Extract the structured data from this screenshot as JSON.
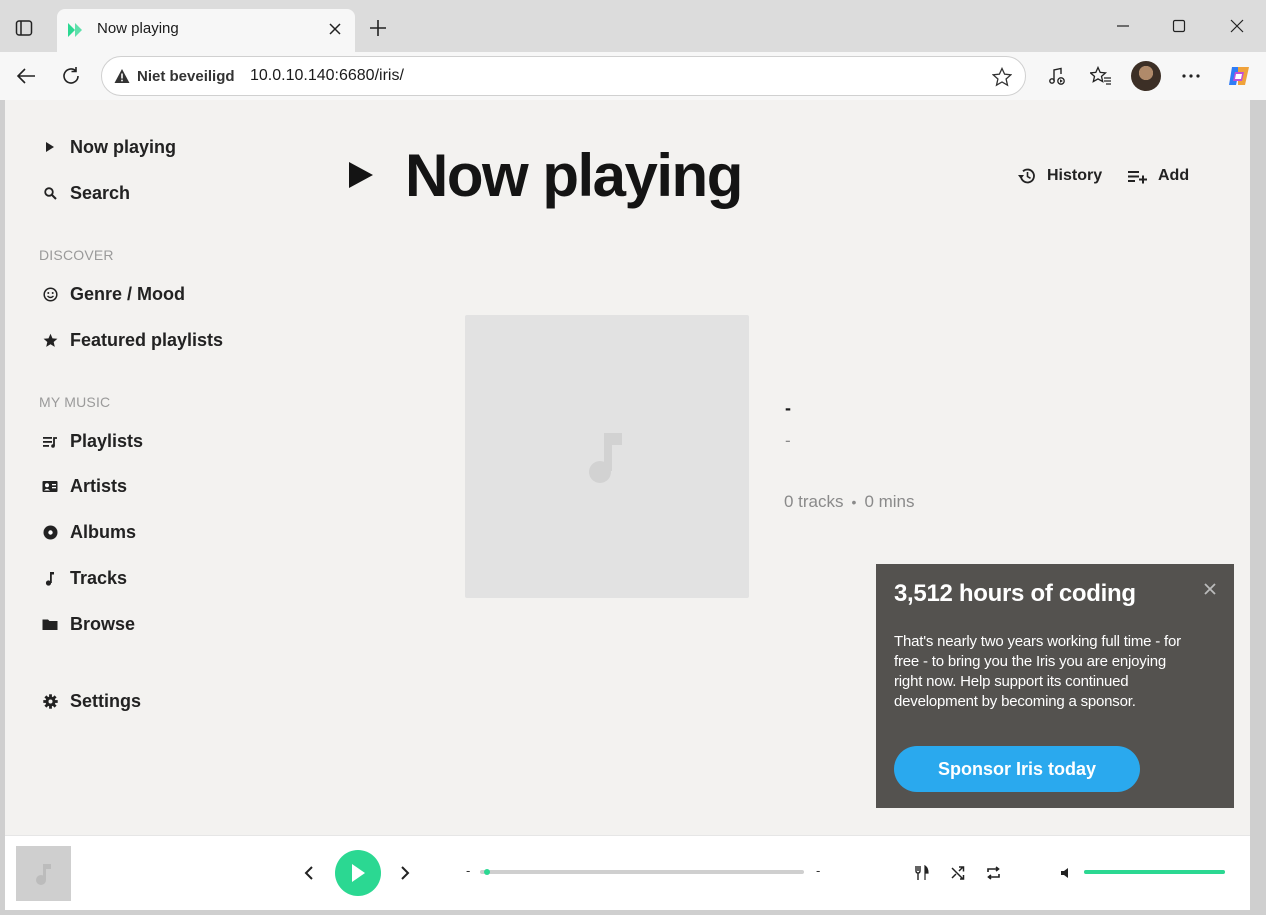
{
  "browser": {
    "tab_title": "Now playing",
    "security_label": "Niet beveiligd",
    "url": "10.0.10.140:6680/iris/"
  },
  "sidebar": {
    "items_top": [
      {
        "label": "Now playing",
        "icon": "play-icon"
      },
      {
        "label": "Search",
        "icon": "search-icon"
      }
    ],
    "discover_heading": "Discover",
    "discover_items": [
      {
        "label": "Genre / Mood",
        "icon": "smiley-icon"
      },
      {
        "label": "Featured playlists",
        "icon": "star-icon"
      }
    ],
    "my_music_heading": "My Music",
    "my_music_items": [
      {
        "label": "Playlists",
        "icon": "playlist-icon"
      },
      {
        "label": "Artists",
        "icon": "artist-icon"
      },
      {
        "label": "Albums",
        "icon": "album-icon"
      },
      {
        "label": "Tracks",
        "icon": "music-note-icon"
      },
      {
        "label": "Browse",
        "icon": "folder-icon"
      }
    ],
    "settings": {
      "label": "Settings",
      "icon": "gear-icon"
    }
  },
  "header": {
    "title": "Now playing",
    "history_label": "History",
    "add_label": "Add"
  },
  "track": {
    "title": "-",
    "artist": "-",
    "tracks_count": "0 tracks",
    "separator": "•",
    "duration": "0 mins"
  },
  "sponsor": {
    "title": "3,512 hours of coding",
    "body": "That's nearly two years working full time - for free - to bring you the Iris you are enjoying right now. Help support its continued development by becoming a sponsor.",
    "button_label": "Sponsor Iris today"
  },
  "player": {
    "elapsed": "-",
    "total": "-",
    "progress_fraction": 0.0,
    "volume_fraction": 1.0
  },
  "colors": {
    "accent": "#2bd892",
    "sponsor_bg": "#54524f",
    "sponsor_button": "#2aa9ee",
    "app_bg": "#f3f2f0"
  }
}
